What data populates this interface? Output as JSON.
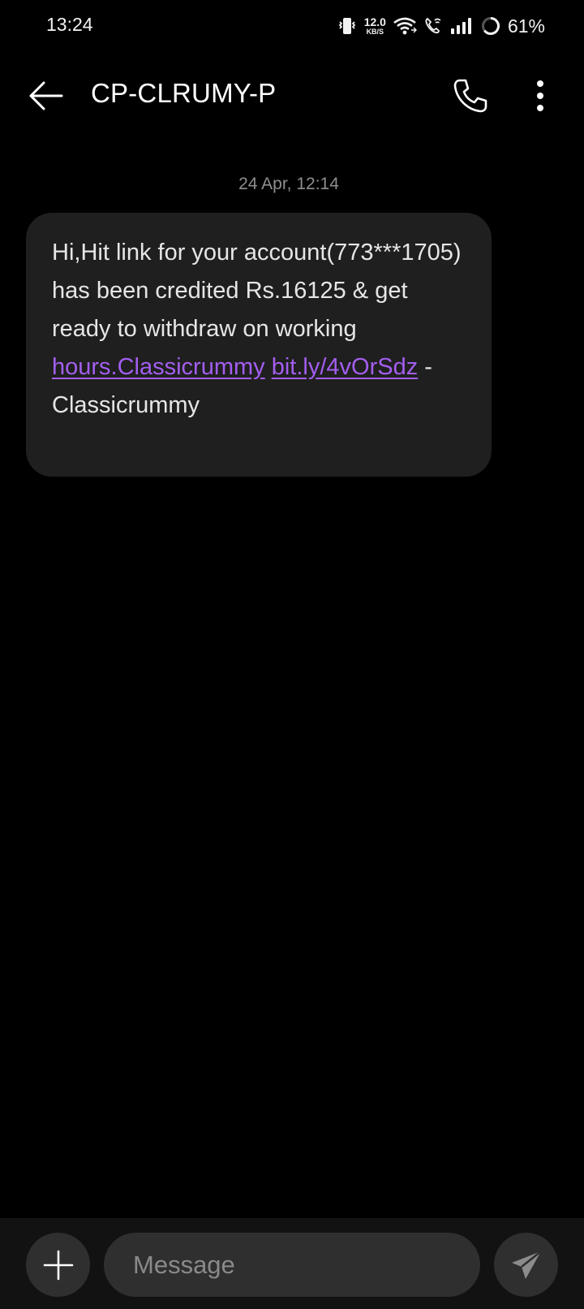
{
  "status_bar": {
    "time": "13:24",
    "net_speed_value": "12.0",
    "net_speed_unit": "KB/S",
    "battery": "61%",
    "icons": [
      "vibrate-icon",
      "wifi-icon",
      "wifi-calling-icon",
      "signal-icon",
      "battery-icon"
    ]
  },
  "header": {
    "title": "CP-CLRUMY-P",
    "icons": [
      "back-arrow-icon",
      "phone-icon",
      "more-vert-icon"
    ]
  },
  "conversation": {
    "timestamp": "24 Apr, 12:14",
    "message": {
      "text_before_links": "Hi,Hit link for your account(773***1705) has been credited Rs.16125 & get ready to withdraw on working ",
      "link1": "hours.Classicrummy",
      "between_links": " ",
      "link2": "bit.ly/4vOrSdz",
      "text_after_links": " - Classicrummy"
    }
  },
  "composer": {
    "placeholder": "Message",
    "value": "",
    "icons": [
      "plus-icon",
      "send-icon"
    ]
  },
  "colors": {
    "background": "#000000",
    "bubble": "#1f1f1f",
    "link": "#a35ef0",
    "composer_bar": "#121212",
    "control": "#2f2f2f"
  }
}
